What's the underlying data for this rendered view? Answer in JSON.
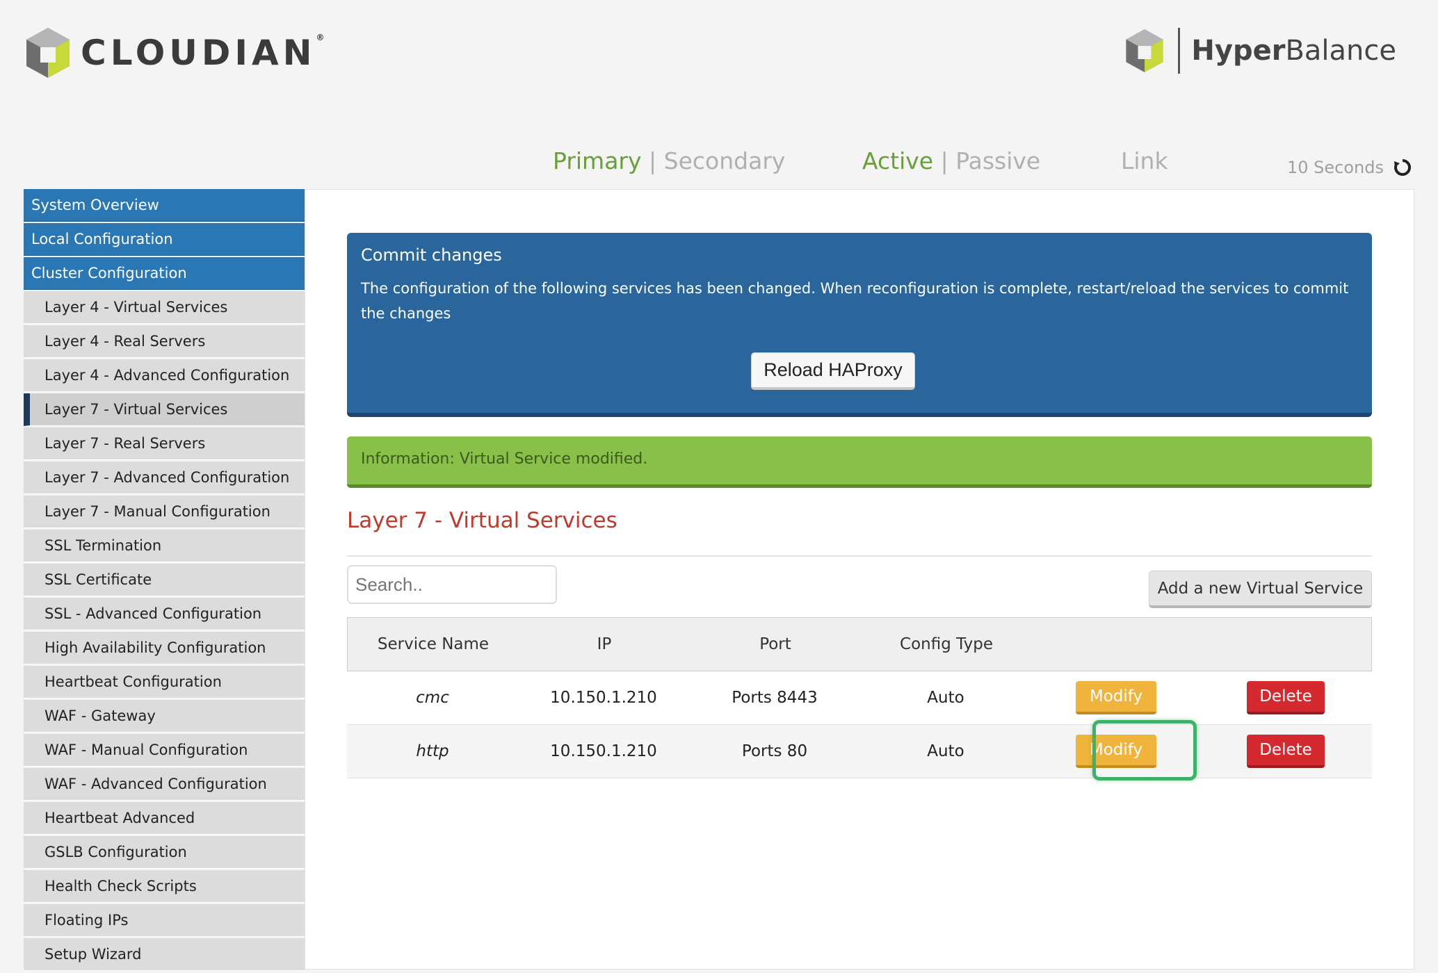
{
  "header": {
    "brand_left": "CLOUDIAN",
    "brand_left_mark": "®",
    "brand_right_bold": "Hyper",
    "brand_right_regular": "Balance"
  },
  "status_bar": {
    "primary": "Primary",
    "secondary": "Secondary",
    "active": "Active",
    "passive": "Passive",
    "link": "Link",
    "separator": "|",
    "refresh_interval": "10 Seconds",
    "refresh_icon": "refresh-icon"
  },
  "sidebar": {
    "items": [
      {
        "label": "System Overview"
      },
      {
        "label": "Local Configuration"
      },
      {
        "label": "Cluster Configuration"
      },
      {
        "label": "Layer 4 - Virtual Services"
      },
      {
        "label": "Layer 4 - Real Servers"
      },
      {
        "label": "Layer 4 - Advanced Configuration"
      },
      {
        "label": "Layer 7 - Virtual Services"
      },
      {
        "label": "Layer 7 - Real Servers"
      },
      {
        "label": "Layer 7 - Advanced Configuration"
      },
      {
        "label": "Layer 7 - Manual Configuration"
      },
      {
        "label": "SSL Termination"
      },
      {
        "label": "SSL Certificate"
      },
      {
        "label": "SSL - Advanced Configuration"
      },
      {
        "label": "High Availability Configuration"
      },
      {
        "label": "Heartbeat Configuration"
      },
      {
        "label": "WAF - Gateway"
      },
      {
        "label": "WAF - Manual Configuration"
      },
      {
        "label": "WAF - Advanced Configuration"
      },
      {
        "label": "Heartbeat Advanced"
      },
      {
        "label": "GSLB Configuration"
      },
      {
        "label": "Health Check Scripts"
      },
      {
        "label": "Floating IPs"
      },
      {
        "label": "Setup Wizard"
      }
    ]
  },
  "commit": {
    "title": "Commit changes",
    "message": "The configuration of the following services has been changed. When reconfiguration is complete, restart/reload the services to commit the changes",
    "reload_label": "Reload HAProxy"
  },
  "info": {
    "message": "Information: Virtual Service modified."
  },
  "main": {
    "title": "Layer 7 - Virtual Services",
    "search_placeholder": "Search..",
    "add_label": "Add a new Virtual Service"
  },
  "table": {
    "columns": [
      "Service Name",
      "IP",
      "Port",
      "Config Type"
    ],
    "rows": [
      {
        "name": "cmc",
        "ip": "10.150.1.210",
        "port": "Ports 8443",
        "config": "Auto",
        "modify": "Modify",
        "delete": "Delete"
      },
      {
        "name": "http",
        "ip": "10.150.1.210",
        "port": "Ports 80",
        "config": "Auto",
        "modify": "Modify",
        "delete": "Delete"
      }
    ]
  },
  "colors": {
    "accent_blue": "#2b77b4",
    "commit_blue": "#2a669b",
    "info_green": "#88c04a",
    "title_red": "#c0392b",
    "modify_orange": "#f0b43c",
    "delete_red": "#d42a2f",
    "highlight_green": "#3db36a"
  }
}
